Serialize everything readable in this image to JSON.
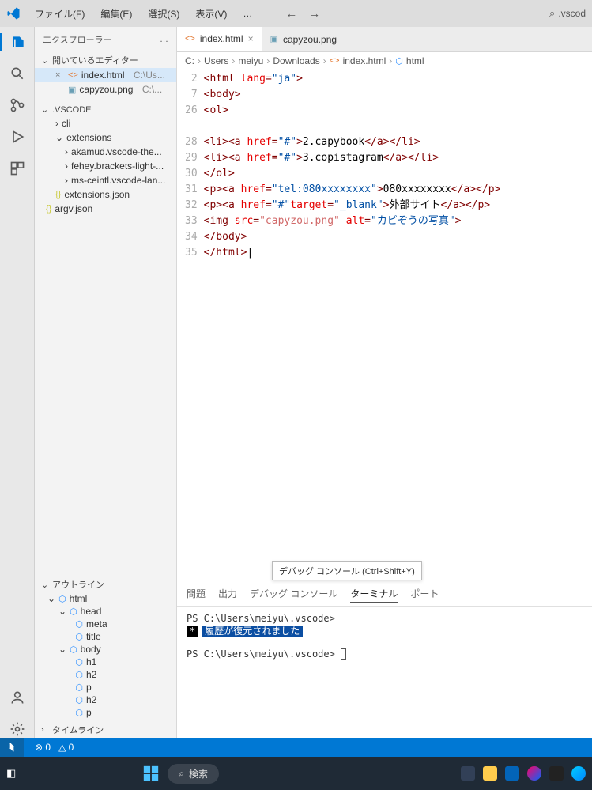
{
  "menu": {
    "file": "ファイル(F)",
    "edit": "編集(E)",
    "select": "選択(S)",
    "view": "表示(V)",
    "more": "…"
  },
  "search_placeholder": ".vscod",
  "sidebar": {
    "header": "エクスプローラー",
    "open_editors": {
      "title": "開いているエディター",
      "items": [
        {
          "name": "index.html",
          "path": "C:\\Us...",
          "closable": true
        },
        {
          "name": "capyzou.png",
          "path": "C:\\...",
          "closable": false
        }
      ]
    },
    "folder": {
      "title": ".VSCODE",
      "items": [
        {
          "label": "cli",
          "kind": "folder",
          "expanded": false,
          "depth": 1
        },
        {
          "label": "extensions",
          "kind": "folder",
          "expanded": true,
          "depth": 1
        },
        {
          "label": "akamud.vscode-the...",
          "kind": "folder",
          "expanded": false,
          "depth": 2
        },
        {
          "label": "fehey.brackets-light-...",
          "kind": "folder",
          "expanded": false,
          "depth": 2
        },
        {
          "label": "ms-ceintl.vscode-lan...",
          "kind": "folder",
          "expanded": false,
          "depth": 2
        },
        {
          "label": "extensions.json",
          "kind": "json",
          "depth": 1
        },
        {
          "label": "argv.json",
          "kind": "json",
          "depth": 0
        }
      ]
    },
    "outline": {
      "title": "アウトライン",
      "nodes": [
        {
          "label": "html",
          "depth": 0
        },
        {
          "label": "head",
          "depth": 1
        },
        {
          "label": "meta",
          "depth": 2
        },
        {
          "label": "title",
          "depth": 2
        },
        {
          "label": "body",
          "depth": 1
        },
        {
          "label": "h1",
          "depth": 2
        },
        {
          "label": "h2",
          "depth": 2
        },
        {
          "label": "p",
          "depth": 2
        },
        {
          "label": "h2",
          "depth": 2
        },
        {
          "label": "p",
          "depth": 2
        }
      ]
    },
    "timeline": "タイムライン"
  },
  "tabs": [
    {
      "name": "index.html",
      "icon": "html",
      "active": true,
      "closable": true
    },
    {
      "name": "capyzou.png",
      "icon": "img",
      "active": false,
      "closable": false
    }
  ],
  "breadcrumbs": [
    "C:",
    "Users",
    "meiyu",
    "Downloads",
    "index.html",
    "html"
  ],
  "code": {
    "numbers": [
      2,
      7,
      26,
      null,
      28,
      29,
      30,
      31,
      32,
      33,
      34,
      35
    ],
    "lines": [
      [
        {
          "t": "tag",
          "v": "<html"
        },
        {
          "t": "txt",
          "v": " "
        },
        {
          "t": "attr",
          "v": "lang"
        },
        {
          "t": "tag",
          "v": "="
        },
        {
          "t": "str",
          "v": "\"ja\""
        },
        {
          "t": "tag",
          "v": ">"
        }
      ],
      [
        {
          "t": "tag",
          "v": "<body>"
        }
      ],
      [
        {
          "t": "tag",
          "v": "<ol>"
        }
      ],
      [],
      [
        {
          "t": "tag",
          "v": "<li><a"
        },
        {
          "t": "txt",
          "v": " "
        },
        {
          "t": "attr",
          "v": "href"
        },
        {
          "t": "tag",
          "v": "="
        },
        {
          "t": "str",
          "v": "\"#\""
        },
        {
          "t": "tag",
          "v": ">"
        },
        {
          "t": "txt",
          "v": "2.capybook"
        },
        {
          "t": "tag",
          "v": "</a></li>"
        }
      ],
      [
        {
          "t": "tag",
          "v": "<li><a"
        },
        {
          "t": "txt",
          "v": " "
        },
        {
          "t": "attr",
          "v": "href"
        },
        {
          "t": "tag",
          "v": "="
        },
        {
          "t": "str",
          "v": "\"#\""
        },
        {
          "t": "tag",
          "v": ">"
        },
        {
          "t": "txt",
          "v": "3.copistagram"
        },
        {
          "t": "tag",
          "v": "</a></li>"
        }
      ],
      [
        {
          "t": "tag",
          "v": "</ol>"
        }
      ],
      [
        {
          "t": "tag",
          "v": "<p><a"
        },
        {
          "t": "txt",
          "v": " "
        },
        {
          "t": "attr",
          "v": "href"
        },
        {
          "t": "tag",
          "v": "="
        },
        {
          "t": "str",
          "v": "\"tel:080xxxxxxxx\""
        },
        {
          "t": "tag",
          "v": ">"
        },
        {
          "t": "txt",
          "v": "080xxxxxxxx"
        },
        {
          "t": "tag",
          "v": "</a></p>"
        }
      ],
      [
        {
          "t": "tag",
          "v": "<p><a"
        },
        {
          "t": "txt",
          "v": " "
        },
        {
          "t": "attr",
          "v": "href"
        },
        {
          "t": "tag",
          "v": "="
        },
        {
          "t": "str",
          "v": "\"#\""
        },
        {
          "t": "attr",
          "v": "target"
        },
        {
          "t": "tag",
          "v": "="
        },
        {
          "t": "str",
          "v": "\"_blank\""
        },
        {
          "t": "tag",
          "v": ">"
        },
        {
          "t": "txt",
          "v": "外部サイト"
        },
        {
          "t": "tag",
          "v": "</a></p>"
        }
      ],
      [
        {
          "t": "tag",
          "v": "<img"
        },
        {
          "t": "txt",
          "v": " "
        },
        {
          "t": "attr",
          "v": "src"
        },
        {
          "t": "tag",
          "v": "="
        },
        {
          "t": "link",
          "v": "\"capyzou.png\""
        },
        {
          "t": "txt",
          "v": " "
        },
        {
          "t": "attr",
          "v": "alt"
        },
        {
          "t": "tag",
          "v": "="
        },
        {
          "t": "str",
          "v": "\"カピぞうの写真\""
        },
        {
          "t": "tag",
          "v": ">"
        }
      ],
      [
        {
          "t": "tag",
          "v": "</body>"
        }
      ],
      [
        {
          "t": "tag",
          "v": "</html>"
        }
      ]
    ]
  },
  "panel": {
    "tooltip": "デバッグ コンソール (Ctrl+Shift+Y)",
    "tabs": {
      "problems": "問題",
      "output": "出力",
      "debug": "デバッグ コンソール",
      "terminal": "ターミナル",
      "ports": "ポート"
    },
    "terminal": {
      "line1": "PS C:\\Users\\meiyu\\.vscode>",
      "history": "履歴が復元されました",
      "line2": "PS C:\\Users\\meiyu\\.vscode> "
    }
  },
  "status": {
    "errors": "0",
    "warnings": "0"
  },
  "taskbar": {
    "search": "検索"
  }
}
